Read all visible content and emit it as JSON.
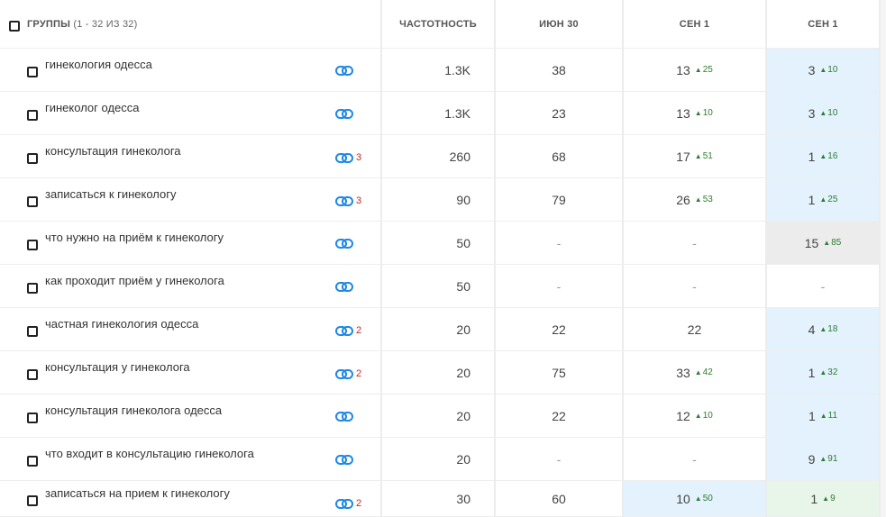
{
  "header": {
    "groups_label": "ГРУППЫ",
    "groups_count": "(1 - 32 ИЗ 32)",
    "col_frequency": "ЧАСТОТНОСТЬ",
    "col_date1": "ИЮН 30",
    "col_date2": "СЕН 1",
    "col_date3": "СЕН 1"
  },
  "rows": [
    {
      "keyword": "гинекология одесса",
      "links": "",
      "frequency": "1.3K",
      "jun30": "38",
      "sep1a": "13",
      "sep1a_up": "25",
      "sep1b": "3",
      "sep1b_up": "10"
    },
    {
      "keyword": "гинеколог одесса",
      "links": "",
      "frequency": "1.3K",
      "jun30": "23",
      "sep1a": "13",
      "sep1a_up": "10",
      "sep1b": "3",
      "sep1b_up": "10"
    },
    {
      "keyword": "консультация гинеколога",
      "links": "3",
      "frequency": "260",
      "jun30": "68",
      "sep1a": "17",
      "sep1a_up": "51",
      "sep1b": "1",
      "sep1b_up": "16"
    },
    {
      "keyword": "записаться к гинекологу",
      "links": "3",
      "frequency": "90",
      "jun30": "79",
      "sep1a": "26",
      "sep1a_up": "53",
      "sep1b": "1",
      "sep1b_up": "25"
    },
    {
      "keyword": "что нужно на приём к гинекологу",
      "links": "",
      "frequency": "50",
      "jun30": "-",
      "sep1a": "-",
      "sep1a_up": "",
      "sep1b": "15",
      "sep1b_up": "85"
    },
    {
      "keyword": "как проходит приём у гинеколога",
      "links": "",
      "frequency": "50",
      "jun30": "-",
      "sep1a": "-",
      "sep1a_up": "",
      "sep1b": "-",
      "sep1b_up": ""
    },
    {
      "keyword": "частная гинекология одесса",
      "links": "2",
      "frequency": "20",
      "jun30": "22",
      "sep1a": "22",
      "sep1a_up": "",
      "sep1b": "4",
      "sep1b_up": "18"
    },
    {
      "keyword": "консультация у гинеколога",
      "links": "2",
      "frequency": "20",
      "jun30": "75",
      "sep1a": "33",
      "sep1a_up": "42",
      "sep1b": "1",
      "sep1b_up": "32"
    },
    {
      "keyword": "консультация гинеколога одесса",
      "links": "",
      "frequency": "20",
      "jun30": "22",
      "sep1a": "12",
      "sep1a_up": "10",
      "sep1b": "1",
      "sep1b_up": "11"
    },
    {
      "keyword": "что входит в консультацию гинеколога",
      "links": "",
      "frequency": "20",
      "jun30": "-",
      "sep1a": "-",
      "sep1a_up": "",
      "sep1b": "9",
      "sep1b_up": "91"
    },
    {
      "keyword": "записаться на прием к гинекологу",
      "links": "2",
      "frequency": "30",
      "jun30": "60",
      "sep1a": "10",
      "sep1a_up": "50",
      "sep1b": "1",
      "sep1b_up": "9"
    }
  ],
  "colors": {
    "highlight_blue": "#e3f2fd",
    "highlight_green": "#e8f5e9",
    "highlight_gray": "#ececec",
    "up_green": "#2e7d32",
    "link_count_red": "#c62828",
    "link_icon_blue": "#1e88e5"
  }
}
